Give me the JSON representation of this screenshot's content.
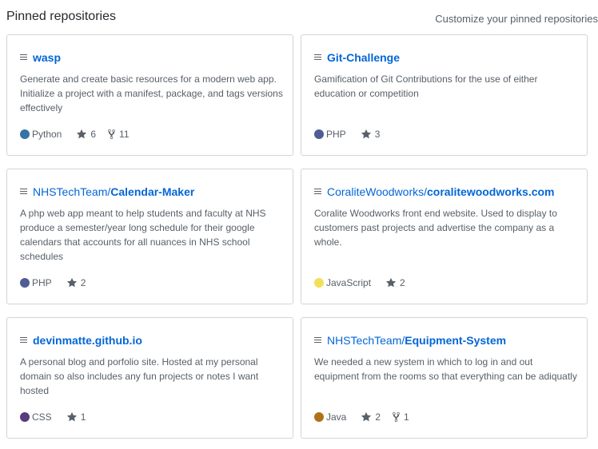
{
  "header": {
    "title": "Pinned repositories",
    "customize_link": "Customize your pinned repositories"
  },
  "repos": [
    {
      "owner": "",
      "name": "wasp",
      "description": "Generate and create basic resources for a modern web app. Initialize a project with a manifest, package, and tags versions effectively",
      "language": "Python",
      "language_color": "#3572A5",
      "stars": "6",
      "forks": "11"
    },
    {
      "owner": "",
      "name": "Git-Challenge",
      "description": "Gamification of Git Contributions for the use of either education or competition",
      "language": "PHP",
      "language_color": "#4F5D95",
      "stars": "3",
      "forks": ""
    },
    {
      "owner": "NHSTechTeam/",
      "name": "Calendar-Maker",
      "description": "A php web app meant to help students and faculty at NHS produce a semester/year long schedule for their google calendars that accounts for all nuances in NHS school schedules",
      "language": "PHP",
      "language_color": "#4F5D95",
      "stars": "2",
      "forks": ""
    },
    {
      "owner": "CoraliteWoodworks/",
      "name": "coralitewoodworks.com",
      "description": "Coralite Woodworks front end website. Used to display to customers past projects and advertise the company as a whole.",
      "language": "JavaScript",
      "language_color": "#F1E05A",
      "stars": "2",
      "forks": ""
    },
    {
      "owner": "",
      "name": "devinmatte.github.io",
      "description": "A personal blog and porfolio site. Hosted at my personal domain so also includes any fun projects or notes I want hosted",
      "language": "CSS",
      "language_color": "#563D7C",
      "stars": "1",
      "forks": ""
    },
    {
      "owner": "NHSTechTeam/",
      "name": "Equipment-System",
      "description": "We needed a new system in which to log in and out equipment from the rooms so that everything can be adiquatly",
      "language": "Java",
      "language_color": "#B07219",
      "stars": "2",
      "forks": "1"
    }
  ]
}
